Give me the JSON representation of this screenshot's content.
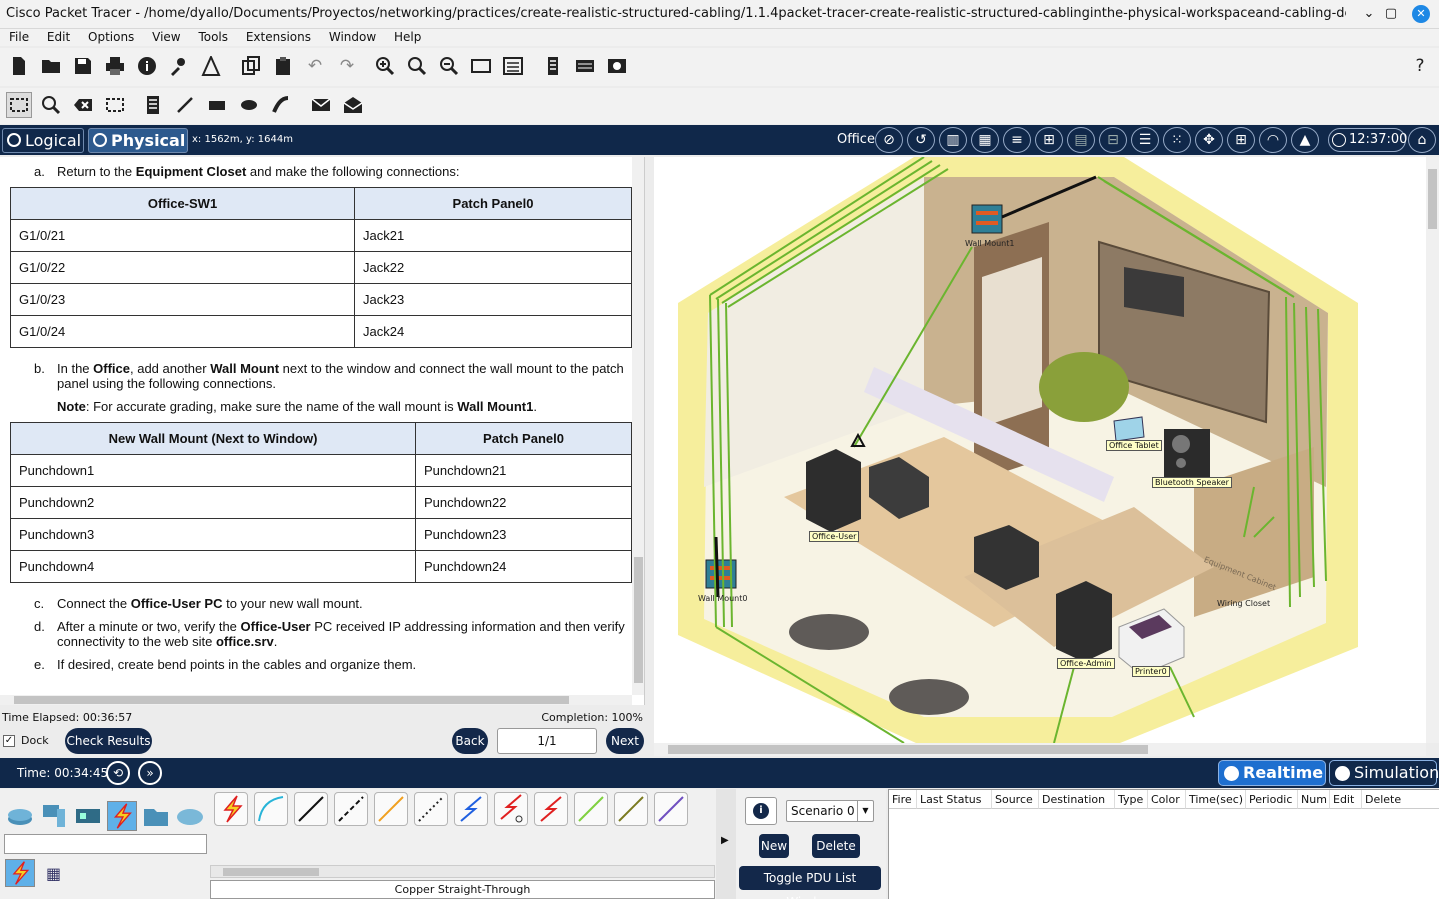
{
  "window": {
    "title": "Cisco Packet Tracer - /home/dyallo/Documents/Proyectos/networking/practices/create-realistic-structured-cabling/1.1.4packet-tracer-create-realistic-structured-cablinginthe-physical-workspaceand-cabling-device...",
    "minimize": "⌄",
    "maximize": "▢",
    "close": "✕"
  },
  "menu": [
    "File",
    "Edit",
    "Options",
    "View",
    "Tools",
    "Extensions",
    "Window",
    "Help"
  ],
  "view_bar": {
    "logical_tab": "Logical",
    "physical_tab": "Physical",
    "coordinates": "x: 1562m, y: 1644m",
    "location": "Office",
    "clock": "12:37:00"
  },
  "instructions": {
    "step_a": {
      "label": "a.",
      "text_before": "Return to the ",
      "bold": "Equipment Closet",
      "text_after": " and make the following connections:"
    },
    "table1": {
      "headers": [
        "Office-SW1",
        "Patch Panel0"
      ],
      "rows": [
        [
          "G1/0/21",
          "Jack21"
        ],
        [
          "G1/0/22",
          "Jack22"
        ],
        [
          "G1/0/23",
          "Jack23"
        ],
        [
          "G1/0/24",
          "Jack24"
        ]
      ]
    },
    "step_b": {
      "label": "b.",
      "t1": "In the ",
      "b1": "Office",
      "t2": ", add another ",
      "b2": "Wall Mount",
      "t3": " next to the window and connect the wall mount to the patch panel using the following connections.",
      "note_bold": "Note",
      "note_text": ": For accurate grading, make sure the name of the wall mount is ",
      "note_name": "Wall Mount1",
      "note_end": "."
    },
    "table2": {
      "headers": [
        "New Wall Mount (Next to Window)",
        "Patch Panel0"
      ],
      "rows": [
        [
          "Punchdown1",
          "Punchdown21"
        ],
        [
          "Punchdown2",
          "Punchdown22"
        ],
        [
          "Punchdown3",
          "Punchdown23"
        ],
        [
          "Punchdown4",
          "Punchdown24"
        ]
      ]
    },
    "step_c": {
      "label": "c.",
      "t1": "Connect the ",
      "b1": "Office-User PC",
      "t2": " to your new wall mount."
    },
    "step_d": {
      "label": "d.",
      "t1": "After a minute or two, verify the ",
      "b1": "Office-User",
      "t2": " PC received IP addressing information and then verify connectivity to the web site ",
      "b2": "office.srv",
      "t3": "."
    },
    "step_e": {
      "label": "e.",
      "text": "If desired, create bend points in the cables and organize them."
    }
  },
  "activity": {
    "time_elapsed": "Time Elapsed: 00:36:57",
    "completion": "Completion: 100%",
    "dock_check": "✓",
    "dock_label": "Dock",
    "check_results": "Check Results",
    "back": "Back",
    "page": "1/1",
    "next": "Next"
  },
  "workspace": {
    "devices": {
      "wall_mount1": "Wall Mount1",
      "wall_mount0": "Wall Mount0",
      "office_tablet": "Office Tablet",
      "bluetooth_speaker": "Bluetooth Speaker",
      "office_user": "Office-User",
      "office_admin": "Office-Admin",
      "printer0": "Printer0"
    },
    "texts": {
      "equipment_cabinet": "Equipment Cabinet",
      "wiring_closet": "Wiring Closet"
    }
  },
  "simulation": {
    "time": "Time: 00:34:45",
    "reset_icon": "⟲",
    "fast_forward_icon": "»",
    "realtime": "Realtime",
    "simulation": "Simulation"
  },
  "cables": {
    "selected_name": "Copper Straight-Through",
    "colors": [
      "#e02020",
      "#28b4d8",
      "#111111",
      "#111111",
      "#f0a020",
      "#222222",
      "#2060e0",
      "#e02020",
      "#e02020",
      "#80d040",
      "#7a7a20",
      "#7050c0"
    ]
  },
  "pdu": {
    "info_icon": "i",
    "scenario": "Scenario 0",
    "dropdown_icon": "▼",
    "new": "New",
    "delete": "Delete",
    "toggle": "Toggle PDU List Window",
    "splitter_icon": "▶",
    "columns": [
      "Fire",
      "Last Status",
      "Source",
      "Destination",
      "Type",
      "Color",
      "Time(sec)",
      "Periodic",
      "Num",
      "Edit",
      "Delete"
    ]
  },
  "toolbar": {
    "help_icon": "?"
  }
}
